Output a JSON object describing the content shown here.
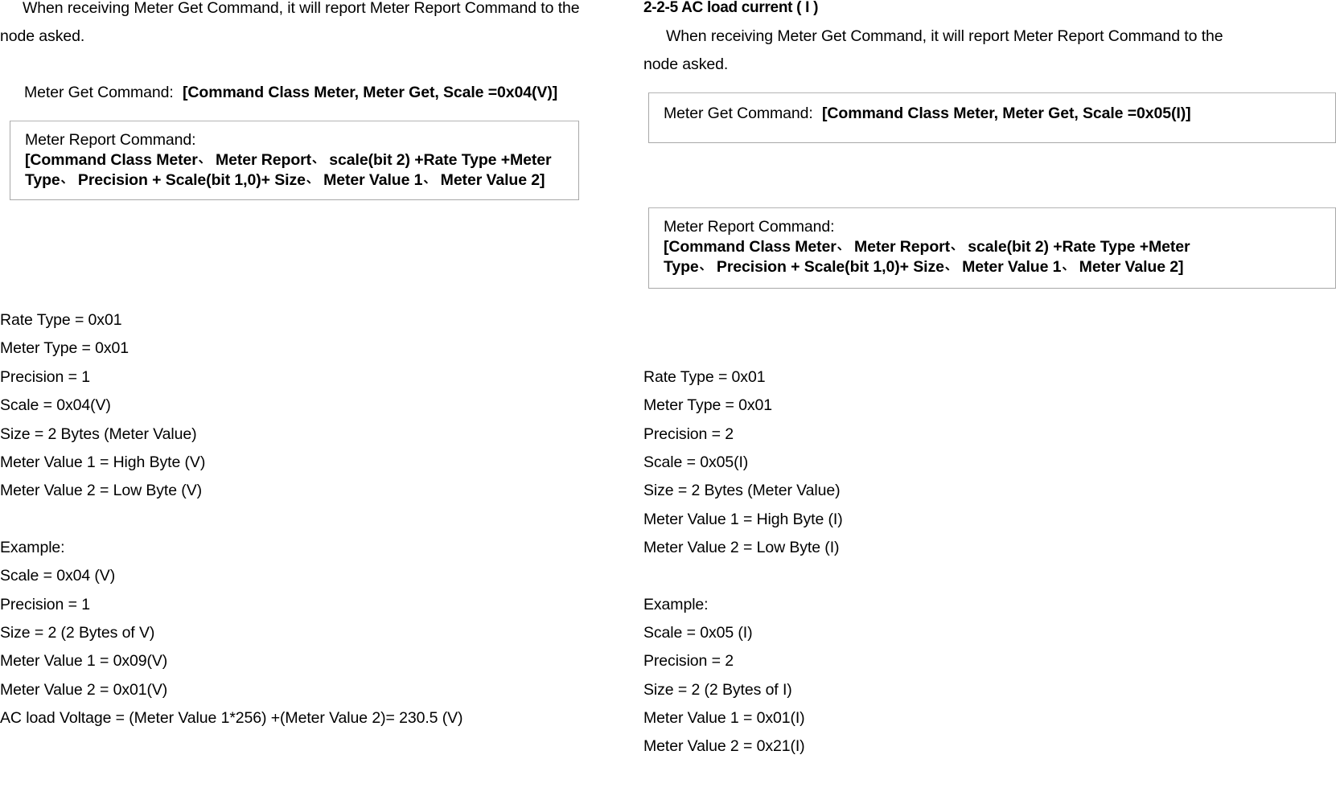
{
  "document": {
    "left_column": {
      "intro_paragraph": {
        "line1": "When receiving Meter Get Command, it will report Meter Report Command to the",
        "line2": "node asked."
      },
      "meter_get": {
        "label": "Meter Get Command:",
        "command": "[Command Class Meter, Meter Get, Scale =0x04(V)]"
      },
      "meter_report_box": {
        "label": "Meter Report Command:",
        "command_line1_a": "[Command Class Meter",
        "command_line1_b": "Meter Report",
        "command_line1_c": "scale(bit 2) +Rate Type +Meter",
        "command_line2_a": "Type",
        "command_line2_b": "Precision + Scale(bit 1,0)+ Size",
        "command_line2_c": "Meter Value 1",
        "command_line2_d": "Meter Value 2]"
      },
      "parameters": [
        "Rate Type = 0x01",
        "Meter Type = 0x01",
        "Precision = 1",
        "Scale = 0x04(V)",
        "Size = 2 Bytes (Meter Value)",
        "Meter Value 1 = High Byte (V)",
        "Meter Value 2 = Low Byte (V)"
      ],
      "example": {
        "label": "Example:",
        "rows": [
          "Scale = 0x04 (V)",
          "Precision = 1",
          "Size = 2 (2 Bytes of  V)",
          "Meter Value 1 =  0x09(V)",
          "Meter Value 2 =  0x01(V)"
        ],
        "result": "AC load Voltage =  (Meter Value 1*256) +(Meter Value 2)= 230.5 (V)"
      }
    },
    "right_column": {
      "section_heading": "2-2-5 AC load current ( I )",
      "intro_paragraph": {
        "line1": "When receiving Meter Get Command, it will report Meter Report Command to the",
        "line2": "node asked."
      },
      "meter_get_box": {
        "label": "Meter Get Command:",
        "command": "[Command Class Meter, Meter Get, Scale =0x05(I)]"
      },
      "meter_report_box": {
        "label": "Meter Report Command:",
        "command_line1_a": "[Command Class Meter",
        "command_line1_b": "Meter Report",
        "command_line1_c": "scale(bit 2) +Rate Type +Meter",
        "command_line2_a": "Type",
        "command_line2_b": "Precision + Scale(bit 1,0)+ Size",
        "command_line2_c": "Meter Value 1",
        "command_line2_d": "Meter Value 2]"
      },
      "parameters": [
        "Rate Type = 0x01",
        "Meter Type = 0x01",
        "Precision = 2",
        "Scale = 0x05(I)",
        "Size = 2 Bytes (Meter Value)",
        "Meter Value 1 = High Byte (I)",
        "Meter Value 2 = Low Byte (I)"
      ],
      "example": {
        "label": "Example:",
        "rows": [
          "Scale = 0x05 (I)",
          "Precision = 2",
          "Size = 2 (2 Bytes of I)",
          "Meter Value 1 =  0x01(I)",
          "Meter Value 2 =  0x21(I)"
        ]
      }
    },
    "separator_comma": "、"
  }
}
